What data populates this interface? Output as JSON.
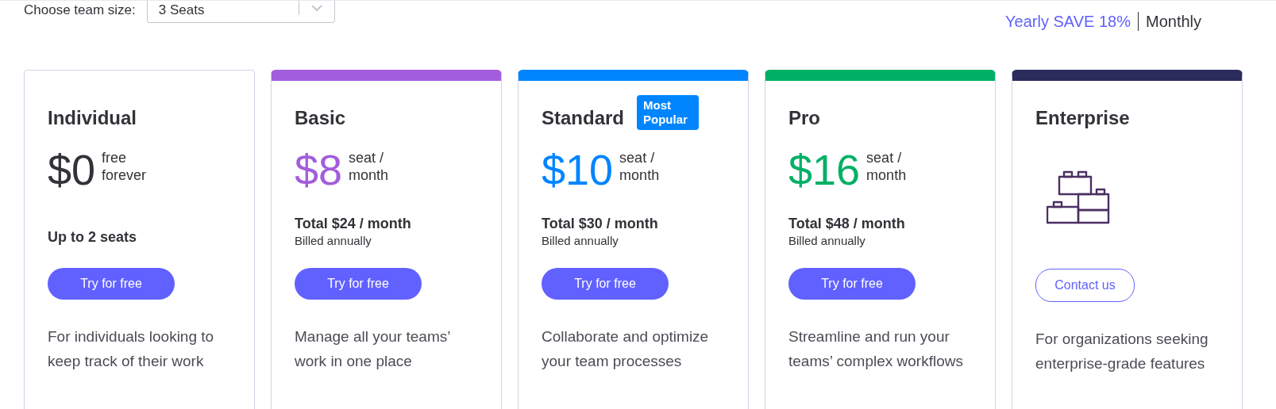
{
  "team_size": {
    "label": "Choose team size:",
    "value": "3 Seats"
  },
  "billing_toggle": [
    {
      "label": "Yearly SAVE 18%",
      "selected": true
    },
    {
      "label": "Monthly",
      "selected": false
    }
  ],
  "plans": [
    {
      "kind": "price",
      "name": "Individual",
      "bar": false,
      "color": "#323338",
      "price": "$0",
      "unit": "free forever",
      "seats": "Up to 2 seats",
      "button": "Try for free",
      "description": "For individuals looking to keep track of their work"
    },
    {
      "kind": "price",
      "name": "Basic",
      "bar": true,
      "color": "#a25ddc",
      "price": "$8",
      "unit": "seat / month",
      "total": "Total $24 / month",
      "billed": "Billed annually",
      "button": "Try for free",
      "description": "Manage all your teams’ work in one place"
    },
    {
      "kind": "price",
      "name": "Standard",
      "bar": true,
      "color": "#0085ff",
      "badge": "Most Popular",
      "price": "$10",
      "unit": "seat / month",
      "total": "Total $30 / month",
      "billed": "Billed annually",
      "button": "Try for free",
      "description": "Collaborate and optimize your team processes"
    },
    {
      "kind": "price",
      "name": "Pro",
      "bar": true,
      "color": "#00b066",
      "price": "$16",
      "unit": "seat / month",
      "total": "Total $48 / month",
      "billed": "Billed annually",
      "button": "Try for free",
      "description": "Streamline and run your teams’ complex workflows"
    },
    {
      "kind": "contact",
      "name": "Enterprise",
      "bar": true,
      "color": "#2b2c5c",
      "button": "Contact us",
      "description": "For organizations seeking enterprise-grade features"
    }
  ]
}
